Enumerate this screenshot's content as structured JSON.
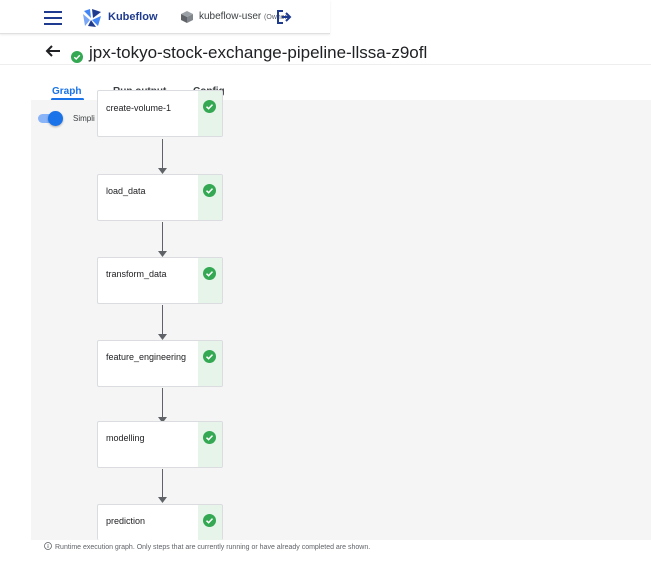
{
  "header": {
    "brand": "Kubeflow",
    "namespace": "kubeflow-user",
    "namespace_role": "(Owner)"
  },
  "run": {
    "title": "jpx-tokyo-stock-exchange-pipeline-llssa-z9ofl",
    "status": "succeeded"
  },
  "tabs": [
    {
      "label": "Graph",
      "active": true
    },
    {
      "label": "Run output",
      "active": false
    },
    {
      "label": "Config",
      "active": false
    }
  ],
  "graph": {
    "simplify_label": "Simpli",
    "simplify_on": true,
    "nodes": [
      {
        "label": "create-volume-1",
        "status": "succeeded"
      },
      {
        "label": "load_data",
        "status": "succeeded"
      },
      {
        "label": "transform_data",
        "status": "succeeded"
      },
      {
        "label": "feature_engineering",
        "status": "succeeded"
      },
      {
        "label": "modelling",
        "status": "succeeded"
      },
      {
        "label": "prediction",
        "status": "succeeded"
      }
    ]
  },
  "footer": {
    "note": "Runtime execution graph. Only steps that are currently running or have already completed are shown."
  },
  "colors": {
    "accent": "#1a73e8",
    "success": "#34a853",
    "success_bg": "#e6f4ea",
    "brand": "#1f3b8f"
  }
}
